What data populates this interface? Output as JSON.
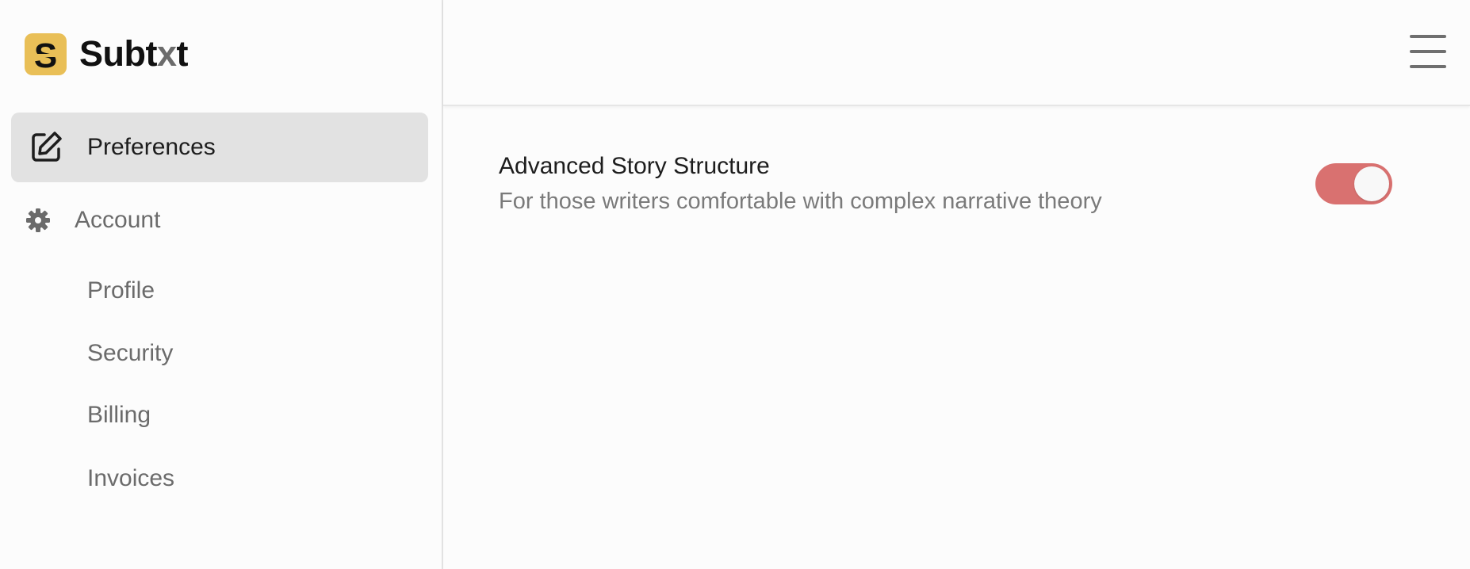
{
  "brand": {
    "logo_letter": "S",
    "name_prefix": "Subt",
    "name_accent": "x",
    "name_suffix": "t",
    "logo_color": "#e9bf57"
  },
  "sidebar": {
    "active_item": {
      "label": "Preferences",
      "icon": "edit-icon"
    },
    "group": {
      "label": "Account",
      "icon": "gear-icon"
    },
    "sub_items": [
      {
        "label": "Profile"
      },
      {
        "label": "Security"
      },
      {
        "label": "Billing"
      },
      {
        "label": "Invoices"
      }
    ]
  },
  "header": {
    "menu_icon": "hamburger-menu-icon"
  },
  "main": {
    "setting": {
      "title": "Advanced Story Structure",
      "description": "For those writers comfortable with complex narrative theory",
      "enabled": true,
      "toggle_color": "#d97170"
    }
  }
}
